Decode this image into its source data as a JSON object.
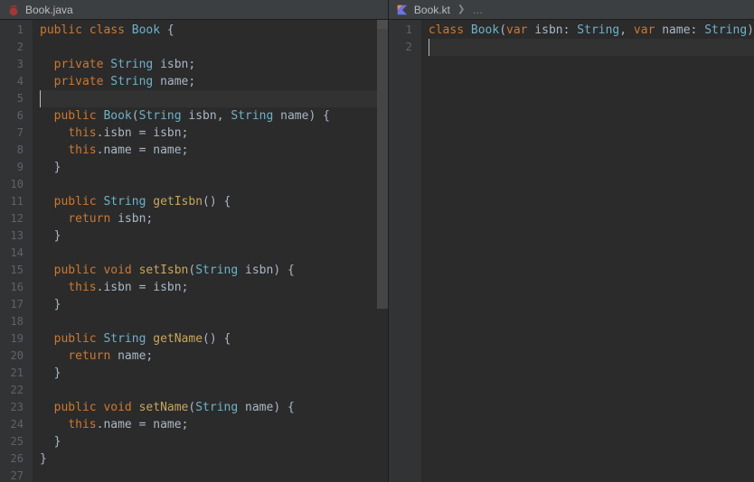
{
  "left": {
    "tab": {
      "filename": "Book.java",
      "icon_fill": "#a33737"
    },
    "lines": [
      [
        [
          "kw",
          "public "
        ],
        [
          "kw",
          "class "
        ],
        [
          "type",
          "Book "
        ],
        [
          "brace",
          "{"
        ]
      ],
      [],
      [
        [
          "param",
          "  "
        ],
        [
          "kw",
          "private "
        ],
        [
          "type",
          "String "
        ],
        [
          "param",
          "isbn"
        ],
        [
          "punc",
          ";"
        ]
      ],
      [
        [
          "param",
          "  "
        ],
        [
          "kw",
          "private "
        ],
        [
          "type",
          "String "
        ],
        [
          "param",
          "name"
        ],
        [
          "punc",
          ";"
        ]
      ],
      [],
      [
        [
          "param",
          "  "
        ],
        [
          "kw",
          "public "
        ],
        [
          "type",
          "Book"
        ],
        [
          "punc",
          "("
        ],
        [
          "type",
          "String "
        ],
        [
          "param",
          "isbn"
        ],
        [
          "punc",
          ", "
        ],
        [
          "type",
          "String "
        ],
        [
          "param",
          "name"
        ],
        [
          "punc",
          ") "
        ],
        [
          "brace",
          "{"
        ]
      ],
      [
        [
          "param",
          "    "
        ],
        [
          "kw",
          "this"
        ],
        [
          "punc",
          "."
        ],
        [
          "param",
          "isbn "
        ],
        [
          "punc",
          "= "
        ],
        [
          "param",
          "isbn"
        ],
        [
          "punc",
          ";"
        ]
      ],
      [
        [
          "param",
          "    "
        ],
        [
          "kw",
          "this"
        ],
        [
          "punc",
          "."
        ],
        [
          "param",
          "name "
        ],
        [
          "punc",
          "= "
        ],
        [
          "param",
          "name"
        ],
        [
          "punc",
          ";"
        ]
      ],
      [
        [
          "param",
          "  "
        ],
        [
          "brace",
          "}"
        ]
      ],
      [],
      [
        [
          "param",
          "  "
        ],
        [
          "kw",
          "public "
        ],
        [
          "type",
          "String "
        ],
        [
          "ident",
          "getIsbn"
        ],
        [
          "punc",
          "() "
        ],
        [
          "brace",
          "{"
        ]
      ],
      [
        [
          "param",
          "    "
        ],
        [
          "kw",
          "return "
        ],
        [
          "param",
          "isbn"
        ],
        [
          "punc",
          ";"
        ]
      ],
      [
        [
          "param",
          "  "
        ],
        [
          "brace",
          "}"
        ]
      ],
      [],
      [
        [
          "param",
          "  "
        ],
        [
          "kw",
          "public "
        ],
        [
          "kw",
          "void "
        ],
        [
          "ident",
          "setIsbn"
        ],
        [
          "punc",
          "("
        ],
        [
          "type",
          "String "
        ],
        [
          "param",
          "isbn"
        ],
        [
          "punc",
          ") "
        ],
        [
          "brace",
          "{"
        ]
      ],
      [
        [
          "param",
          "    "
        ],
        [
          "kw",
          "this"
        ],
        [
          "punc",
          "."
        ],
        [
          "param",
          "isbn "
        ],
        [
          "punc",
          "= "
        ],
        [
          "param",
          "isbn"
        ],
        [
          "punc",
          ";"
        ]
      ],
      [
        [
          "param",
          "  "
        ],
        [
          "brace",
          "}"
        ]
      ],
      [],
      [
        [
          "param",
          "  "
        ],
        [
          "kw",
          "public "
        ],
        [
          "type",
          "String "
        ],
        [
          "ident",
          "getName"
        ],
        [
          "punc",
          "() "
        ],
        [
          "brace",
          "{"
        ]
      ],
      [
        [
          "param",
          "    "
        ],
        [
          "kw",
          "return "
        ],
        [
          "param",
          "name"
        ],
        [
          "punc",
          ";"
        ]
      ],
      [
        [
          "param",
          "  "
        ],
        [
          "brace",
          "}"
        ]
      ],
      [],
      [
        [
          "param",
          "  "
        ],
        [
          "kw",
          "public "
        ],
        [
          "kw",
          "void "
        ],
        [
          "ident",
          "setName"
        ],
        [
          "punc",
          "("
        ],
        [
          "type",
          "String "
        ],
        [
          "param",
          "name"
        ],
        [
          "punc",
          ") "
        ],
        [
          "brace",
          "{"
        ]
      ],
      [
        [
          "param",
          "    "
        ],
        [
          "kw",
          "this"
        ],
        [
          "punc",
          "."
        ],
        [
          "param",
          "name "
        ],
        [
          "punc",
          "= "
        ],
        [
          "param",
          "name"
        ],
        [
          "punc",
          ";"
        ]
      ],
      [
        [
          "param",
          "  "
        ],
        [
          "brace",
          "}"
        ]
      ],
      [
        [
          "brace",
          "}"
        ]
      ],
      []
    ],
    "highlight_line_index": 4
  },
  "right": {
    "tab": {
      "filename": "Book.kt",
      "breadcrumb_dots": "…"
    },
    "lines": [
      [
        [
          "kw",
          "class "
        ],
        [
          "type",
          "Book"
        ],
        [
          "punc",
          "("
        ],
        [
          "kw",
          "var "
        ],
        [
          "param",
          "isbn"
        ],
        [
          "punc",
          ": "
        ],
        [
          "type",
          "String"
        ],
        [
          "punc",
          ", "
        ],
        [
          "kw",
          "var "
        ],
        [
          "param",
          "name"
        ],
        [
          "punc",
          ": "
        ],
        [
          "type",
          "String"
        ],
        [
          "punc",
          ")"
        ]
      ],
      []
    ],
    "highlight_line_index": 1
  }
}
